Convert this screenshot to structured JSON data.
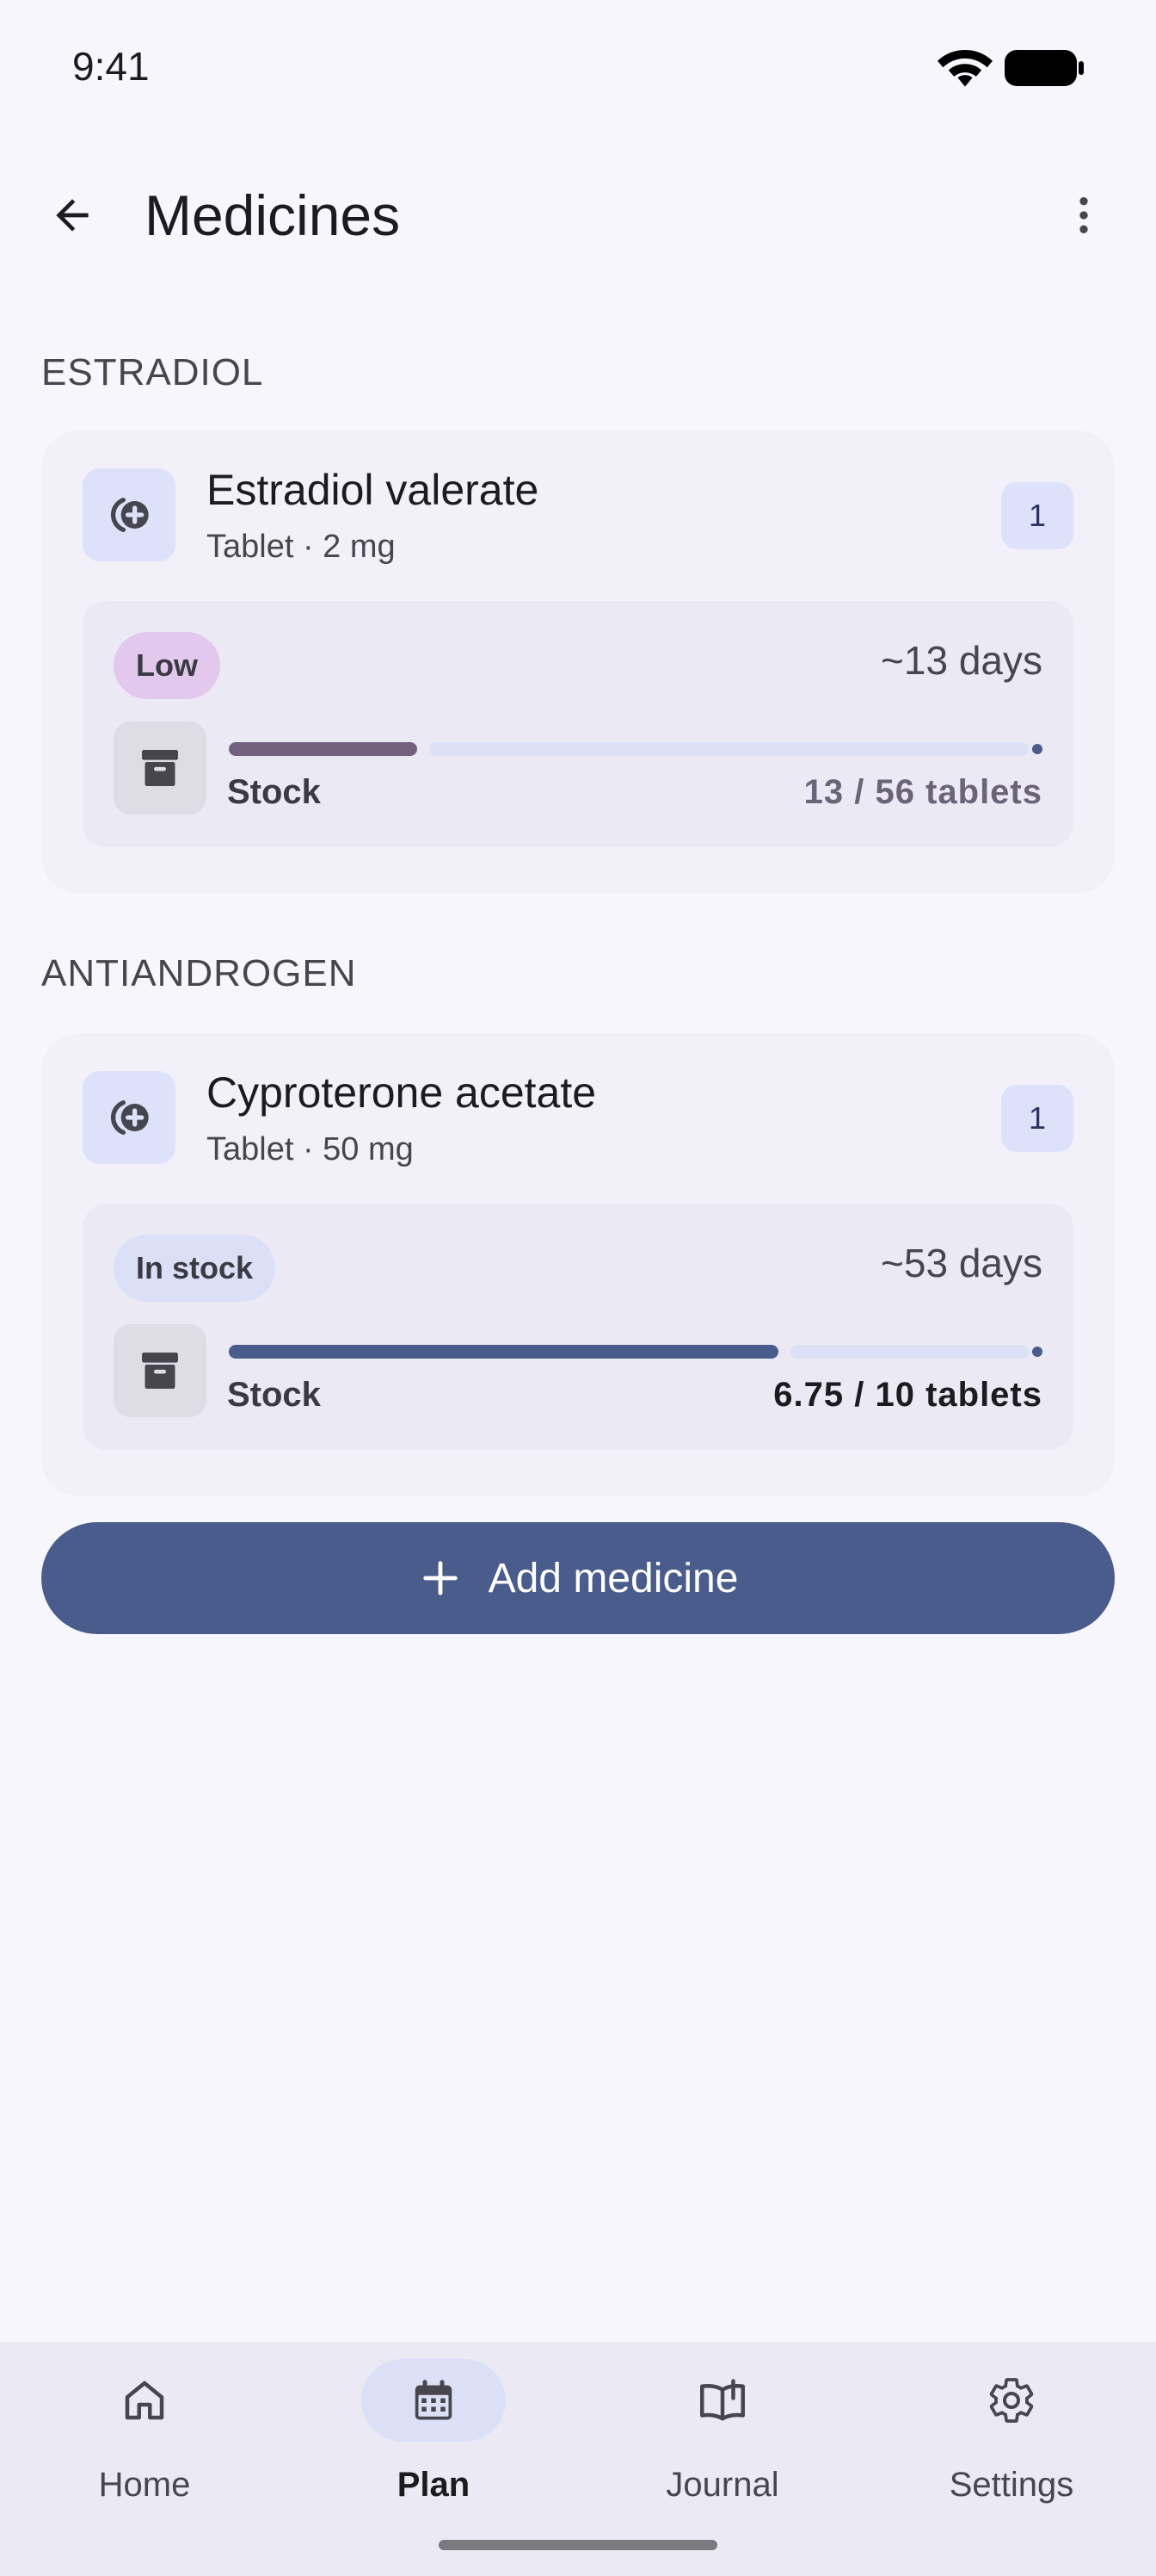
{
  "status_bar": {
    "time": "9:41"
  },
  "header": {
    "title": "Medicines"
  },
  "sections": [
    {
      "title": "ESTRADIOL",
      "medicine": {
        "name": "Estradiol valerate",
        "form": "Tablet · 2 mg",
        "count": "1",
        "status": "Low",
        "days_left": "~13 days",
        "stock_label": "Stock",
        "stock_amount": "13 / 56 tablets",
        "stock_fraction": 0.232
      }
    },
    {
      "title": "ANTIANDROGEN",
      "medicine": {
        "name": "Cyproterone acetate",
        "form": "Tablet · 50 mg",
        "count": "1",
        "status": "In stock",
        "days_left": "~53 days",
        "stock_label": "Stock",
        "stock_amount": "6.75 / 10 tablets",
        "stock_fraction": 0.675
      }
    }
  ],
  "add_button": {
    "label": "Add medicine"
  },
  "nav": {
    "items": [
      {
        "label": "Home",
        "icon": "home-icon"
      },
      {
        "label": "Plan",
        "icon": "calendar-icon",
        "active": true
      },
      {
        "label": "Journal",
        "icon": "journal-icon"
      },
      {
        "label": "Settings",
        "icon": "gear-icon"
      }
    ]
  },
  "colors": {
    "primary": "#4a5c8c",
    "low_fill": "#72617e",
    "ok_fill": "#4a5c8c",
    "low_chip": "#e3c8ee",
    "ok_chip": "#dbe0f7",
    "background": "#f8f6fd"
  }
}
